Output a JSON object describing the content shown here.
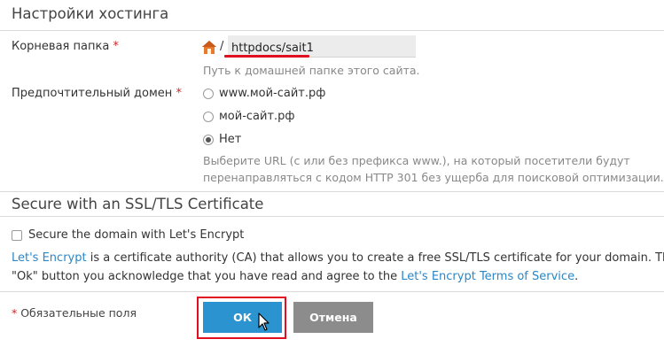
{
  "hosting": {
    "title": "Настройки хостинга",
    "root_folder": {
      "label": "Корневая папка",
      "required_mark": "*",
      "separator": "/",
      "value": "httpdocs/sait1",
      "hint": "Путь к домашней папке этого сайта."
    },
    "preferred_domain": {
      "label": "Предпочтительный домен",
      "required_mark": "*",
      "options": [
        {
          "label": "www.мой-сайт.рф",
          "checked": false
        },
        {
          "label": "мой-сайт.рф",
          "checked": false
        },
        {
          "label": "Нет",
          "checked": true
        }
      ],
      "hint_line1": "Выберите URL (с или без префикса www.), на который посетители будут",
      "hint_line2": "перенаправляться с кодом HTTP 301 без ущерба для поисковой оптимизации."
    }
  },
  "ssl": {
    "title": "Secure with an SSL/TLS Certificate",
    "checkbox_label": "Secure the domain with Let's Encrypt",
    "checkbox_checked": false,
    "desc_link1": "Let's Encrypt",
    "desc_line1": " is a certificate authority (CA) that allows you to create a free SSL/TLS certificate for your domain. The certifica",
    "desc_line2_prefix": "\"Ok\" button you acknowledge that you have read and agree to the ",
    "desc_link2": "Let's Encrypt Terms of Service",
    "desc_line2_suffix": "."
  },
  "footer": {
    "required_mark": "*",
    "required_note": " Обязательные поля",
    "ok_label": "ОК",
    "cancel_label": "Отмена"
  },
  "icons": {
    "home": "home-icon",
    "cursor": "mouse-pointer-icon"
  },
  "colors": {
    "accent": "#2b93d0",
    "link": "#2a87c7",
    "required": "#d02323",
    "highlight": "#e01020",
    "cancel": "#8c8c8c"
  }
}
